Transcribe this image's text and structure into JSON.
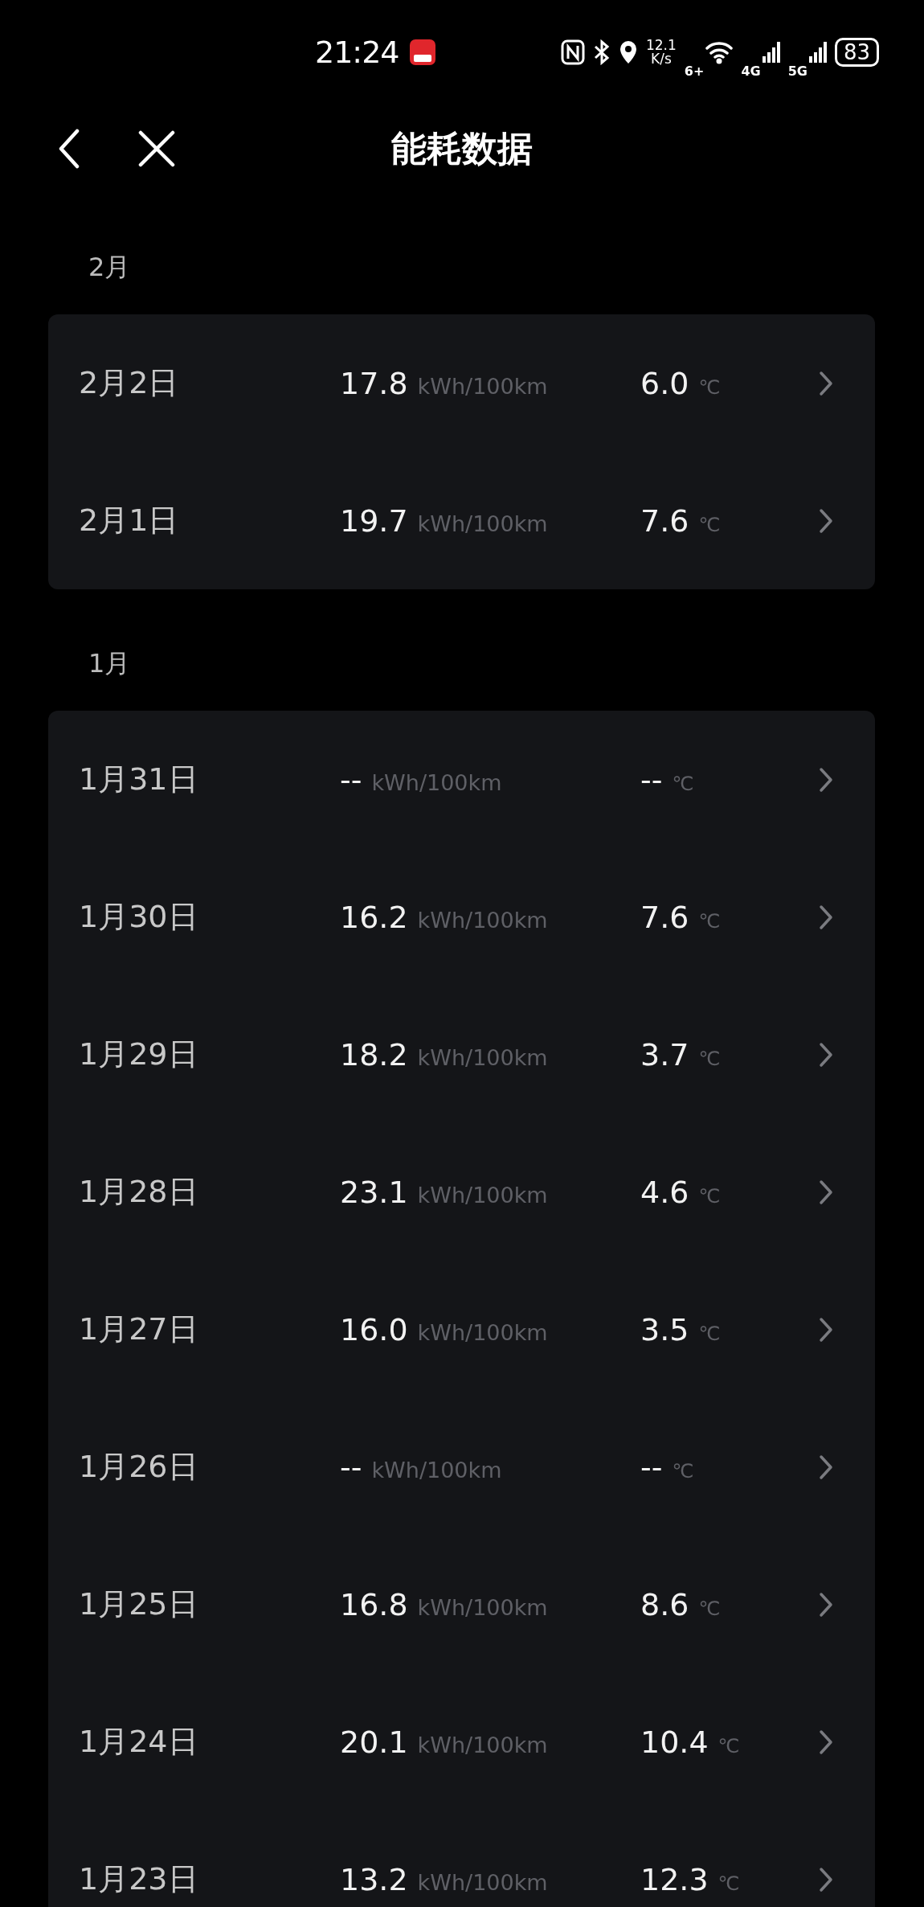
{
  "status_bar": {
    "time": "21:24",
    "network_speed": "12.1",
    "network_speed_unit": "K/s",
    "wifi_badge": "6+",
    "sim1": "4G",
    "sim2": "5G",
    "battery": "83"
  },
  "header": {
    "title": "能耗数据"
  },
  "sections": [
    {
      "month": "2月",
      "days": [
        {
          "date": "2月2日",
          "consumption": "17.8",
          "consumption_unit": "kWh/100km",
          "temperature": "6.0",
          "temperature_unit": "℃"
        },
        {
          "date": "2月1日",
          "consumption": "19.7",
          "consumption_unit": "kWh/100km",
          "temperature": "7.6",
          "temperature_unit": "℃"
        }
      ]
    },
    {
      "month": "1月",
      "days": [
        {
          "date": "1月31日",
          "consumption": "--",
          "consumption_unit": "kWh/100km",
          "temperature": "--",
          "temperature_unit": "℃"
        },
        {
          "date": "1月30日",
          "consumption": "16.2",
          "consumption_unit": "kWh/100km",
          "temperature": "7.6",
          "temperature_unit": "℃"
        },
        {
          "date": "1月29日",
          "consumption": "18.2",
          "consumption_unit": "kWh/100km",
          "temperature": "3.7",
          "temperature_unit": "℃"
        },
        {
          "date": "1月28日",
          "consumption": "23.1",
          "consumption_unit": "kWh/100km",
          "temperature": "4.6",
          "temperature_unit": "℃"
        },
        {
          "date": "1月27日",
          "consumption": "16.0",
          "consumption_unit": "kWh/100km",
          "temperature": "3.5",
          "temperature_unit": "℃"
        },
        {
          "date": "1月26日",
          "consumption": "--",
          "consumption_unit": "kWh/100km",
          "temperature": "--",
          "temperature_unit": "℃"
        },
        {
          "date": "1月25日",
          "consumption": "16.8",
          "consumption_unit": "kWh/100km",
          "temperature": "8.6",
          "temperature_unit": "℃"
        },
        {
          "date": "1月24日",
          "consumption": "20.1",
          "consumption_unit": "kWh/100km",
          "temperature": "10.4",
          "temperature_unit": "℃"
        },
        {
          "date": "1月23日",
          "consumption": "13.2",
          "consumption_unit": "kWh/100km",
          "temperature": "12.3",
          "temperature_unit": "℃"
        }
      ]
    }
  ]
}
